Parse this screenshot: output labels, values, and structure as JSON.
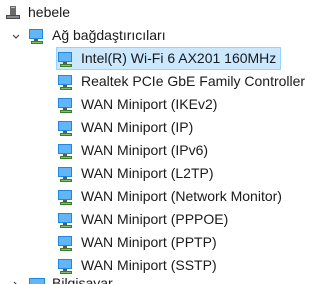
{
  "root": {
    "label": "hebele",
    "icon": "computer-tower-icon"
  },
  "category": {
    "label": "Ağ bağdaştırıcıları",
    "icon": "network-adapter-icon",
    "expanded": true
  },
  "devices": [
    {
      "label": "Intel(R) Wi-Fi 6 AX201 160MHz",
      "icon": "network-adapter-icon",
      "selected": true
    },
    {
      "label": "Realtek PCIe GbE Family Controller",
      "icon": "network-adapter-icon",
      "selected": false
    },
    {
      "label": "WAN Miniport (IKEv2)",
      "icon": "network-adapter-icon",
      "selected": false
    },
    {
      "label": "WAN Miniport (IP)",
      "icon": "network-adapter-icon",
      "selected": false
    },
    {
      "label": "WAN Miniport (IPv6)",
      "icon": "network-adapter-icon",
      "selected": false
    },
    {
      "label": "WAN Miniport (L2TP)",
      "icon": "network-adapter-icon",
      "selected": false
    },
    {
      "label": "WAN Miniport (Network Monitor)",
      "icon": "network-adapter-icon",
      "selected": false
    },
    {
      "label": "WAN Miniport (PPPOE)",
      "icon": "network-adapter-icon",
      "selected": false
    },
    {
      "label": "WAN Miniport (PPTP)",
      "icon": "network-adapter-icon",
      "selected": false
    },
    {
      "label": "WAN Miniport (SSTP)",
      "icon": "network-adapter-icon",
      "selected": false
    }
  ],
  "next_category": {
    "label": "Bilgisayar",
    "icon": "computer-monitor-icon",
    "expanded": false
  },
  "colors": {
    "selection_bg": "#cce8ff",
    "selection_border": "#99d1ff",
    "monitor_blue": "#1e88e5"
  }
}
